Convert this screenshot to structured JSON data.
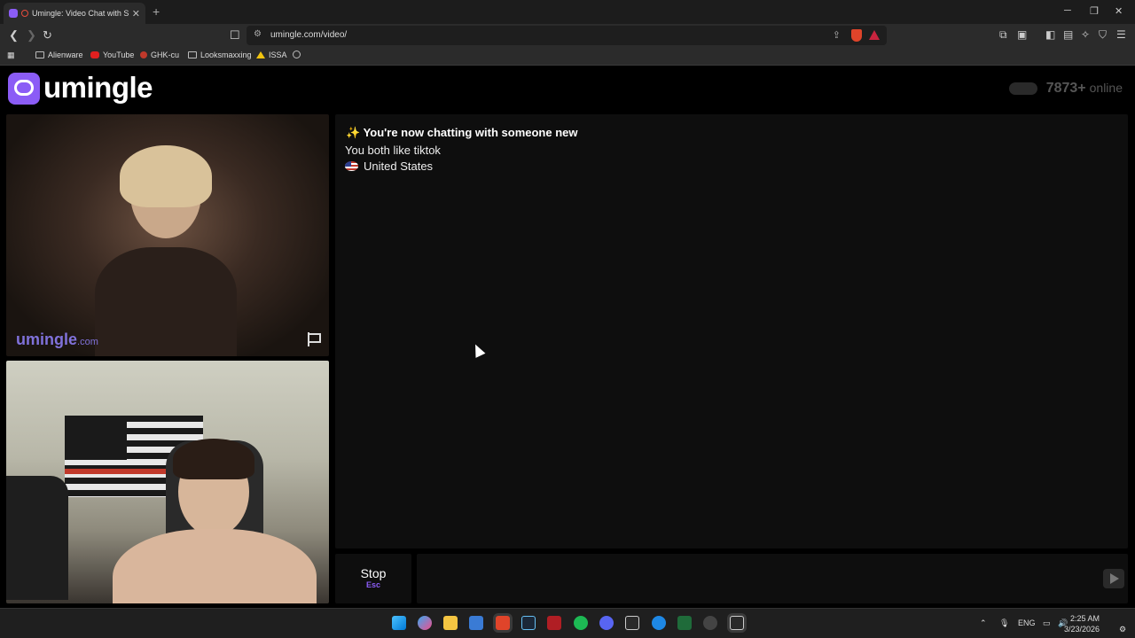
{
  "browser": {
    "tab_title": "Umingle: Video Chat with Stra",
    "url": "umingle.com/video/",
    "bookmarks": [
      {
        "label": "Alienware",
        "icon": "folder-icon"
      },
      {
        "label": "YouTube",
        "icon": "youtube-icon"
      },
      {
        "label": "GHK-cu",
        "icon": "red-dot-icon"
      },
      {
        "label": "Looksmaxxing",
        "icon": "folder-icon"
      },
      {
        "label": "ISSA",
        "icon": "issa-icon"
      }
    ]
  },
  "site": {
    "logo_text": "umingle",
    "online_count": "7873+",
    "online_label": "online"
  },
  "remote_video": {
    "watermark": "umingle",
    "watermark_suffix": ".com"
  },
  "chat": {
    "line1_icon": "✨",
    "line1": "You're now chatting with someone new",
    "line2": "You both like tiktok",
    "country": "United States"
  },
  "controls": {
    "stop_label": "Stop",
    "stop_shortcut": "Esc",
    "message_placeholder": ""
  },
  "taskbar": {
    "lang": "ENG",
    "time": "2:25 AM",
    "date": "3/23/2026"
  },
  "colors": {
    "brand": "#8b5cf6",
    "panel": "#0e0e0e",
    "background": "#000000"
  }
}
